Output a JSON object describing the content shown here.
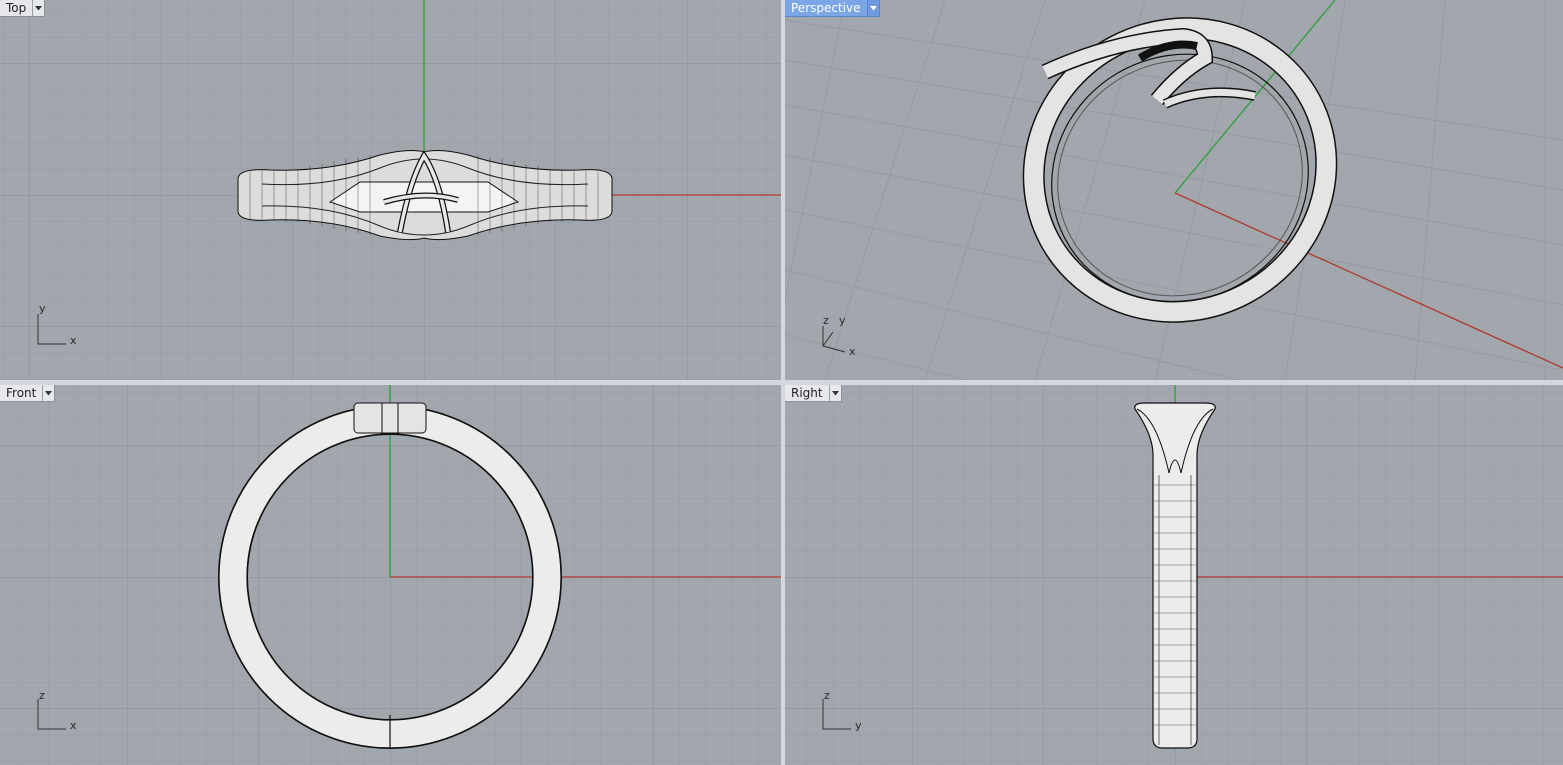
{
  "viewports": {
    "top": {
      "title": "Top",
      "axis_h": "x",
      "axis_v": "y",
      "active": false
    },
    "perspective": {
      "title": "Perspective",
      "axis_a": "z",
      "axis_b": "y",
      "axis_c": "x",
      "active": true
    },
    "front": {
      "title": "Front",
      "axis_h": "x",
      "axis_v": "z",
      "active": false
    },
    "right": {
      "title": "Right",
      "axis_h": "y",
      "axis_v": "z",
      "active": false
    }
  },
  "colors": {
    "viewport_bg": "#a2a6ad",
    "grid_minor": "#969aa1",
    "grid_major": "#8a8e95",
    "axis_x": "#b03a2e",
    "axis_y": "#2f9e3a",
    "active_tab": "#7aa6e8"
  },
  "icons": {
    "viewport_menu": "chevron-down-icon"
  }
}
